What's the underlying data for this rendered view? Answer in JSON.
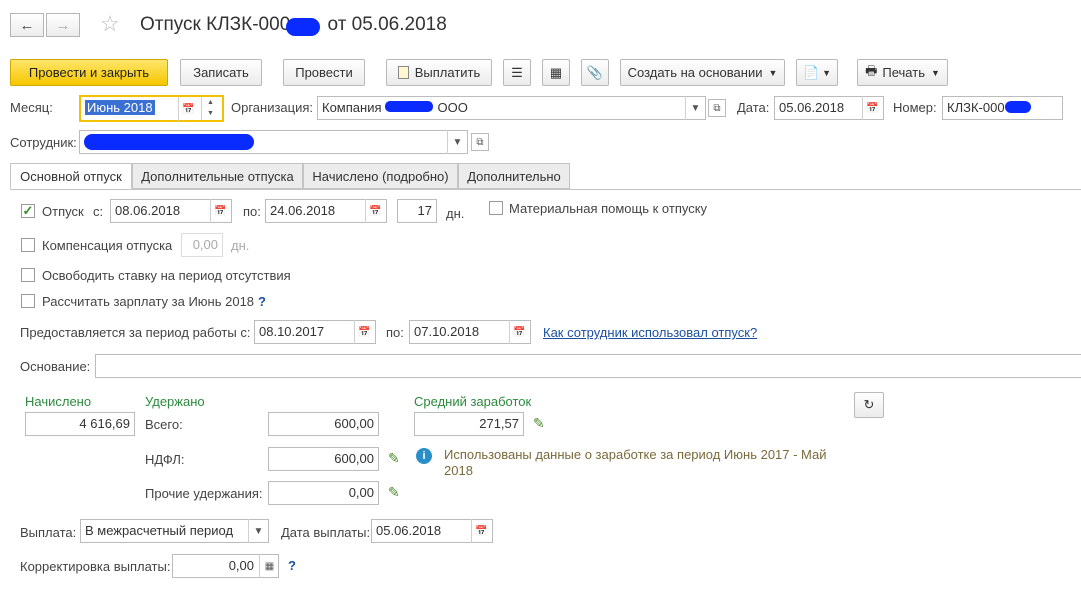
{
  "header": {
    "title": "Отпуск КЛЗК-000",
    "title_suffix": "от 05.06.2018"
  },
  "toolbar": {
    "post_close": "Провести и закрыть",
    "save": "Записать",
    "post": "Провести",
    "pay": "Выплатить",
    "create_based": "Создать на основании",
    "print": "Печать"
  },
  "form": {
    "month_label": "Месяц:",
    "month_value": "Июнь 2018",
    "org_label": "Организация:",
    "org_value_prefix": "Компания",
    "org_value_suffix": "ООО",
    "date_label": "Дата:",
    "date_value": "05.06.2018",
    "number_label": "Номер:",
    "number_value": "КЛЗК-000",
    "employee_label": "Сотрудник:"
  },
  "tabs": [
    "Основной отпуск",
    "Дополнительные отпуска",
    "Начислено (подробно)",
    "Дополнительно"
  ],
  "main": {
    "vacation_label": "Отпуск",
    "from_label": "с:",
    "from_value": "08.06.2018",
    "to_label": "по:",
    "to_value": "24.06.2018",
    "days_value": "17",
    "days_label": "дн.",
    "material_aid": "Материальная помощь к отпуску",
    "compensation_label": "Компенсация отпуска",
    "compensation_value": "0,00",
    "compensation_unit": "дн.",
    "free_rate": "Освободить ставку на период отсутствия",
    "calc_salary": "Рассчитать зарплату за Июнь 2018",
    "question": "?",
    "period_label": "Предоставляется за период работы с:",
    "period_from": "08.10.2017",
    "period_to_label": "по:",
    "period_to": "07.10.2018",
    "usage_link": "Как сотрудник использовал отпуск?",
    "basis_label": "Основание:",
    "accrued_label": "Начислено",
    "accrued_value": "4 616,69",
    "withheld_label": "Удержано",
    "total_label": "Всего:",
    "total_value": "600,00",
    "ndfl_label": "НДФЛ:",
    "ndfl_value": "600,00",
    "other_label": "Прочие удержания:",
    "other_value": "0,00",
    "avg_label": "Средний заработок",
    "avg_value": "271,57",
    "info_text_1": "Использованы данные о заработке за период Июнь 2017 - Май",
    "info_text_2": "2018",
    "payout_label": "Выплата:",
    "payout_value": "В межрасчетный период",
    "payout_date_label": "Дата выплаты:",
    "payout_date_value": "05.06.2018",
    "correction_label": "Корректировка выплаты:",
    "correction_value": "0,00"
  },
  "colors": {
    "primary": "#f5c600",
    "green": "#2b8a3e",
    "link": "#1b4fa0",
    "focus": "#f2c200"
  }
}
